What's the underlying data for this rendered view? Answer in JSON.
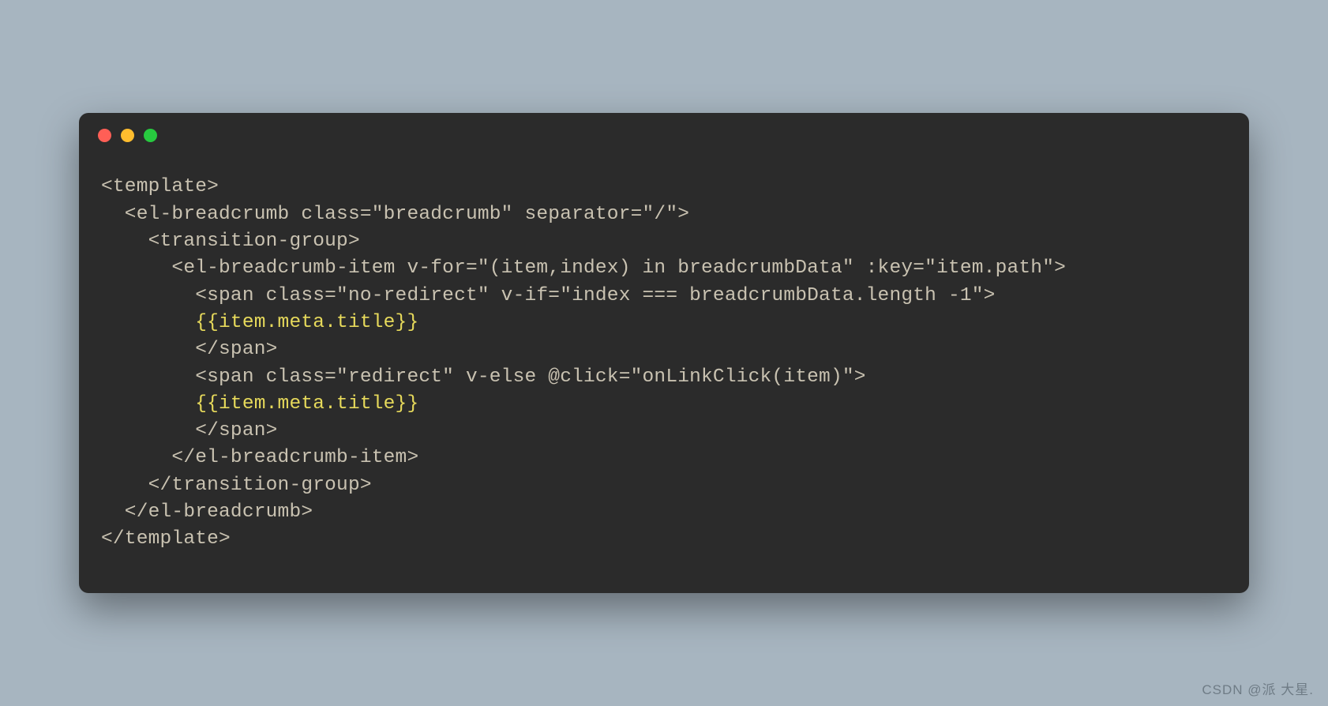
{
  "code": {
    "lines": [
      {
        "indent": 0,
        "type": "tag",
        "text": "<template>"
      },
      {
        "indent": 1,
        "type": "tag",
        "text": "<el-breadcrumb class=\"breadcrumb\" separator=\"/\">"
      },
      {
        "indent": 2,
        "type": "tag",
        "text": "<transition-group>"
      },
      {
        "indent": 3,
        "type": "tag",
        "text": "<el-breadcrumb-item v-for=\"(item,index) in breadcrumbData\" :key=\"item.path\">"
      },
      {
        "indent": 4,
        "type": "tag",
        "text": "<span class=\"no-redirect\" v-if=\"index === breadcrumbData.length -1\">"
      },
      {
        "indent": 4,
        "type": "highlight",
        "text": "{{item.meta.title}}"
      },
      {
        "indent": 4,
        "type": "tag",
        "text": "</span>"
      },
      {
        "indent": 4,
        "type": "tag",
        "text": "<span class=\"redirect\" v-else @click=\"onLinkClick(item)\">"
      },
      {
        "indent": 4,
        "type": "highlight",
        "text": "{{item.meta.title}}"
      },
      {
        "indent": 4,
        "type": "tag",
        "text": "</span>"
      },
      {
        "indent": 3,
        "type": "tag",
        "text": "</el-breadcrumb-item>"
      },
      {
        "indent": 2,
        "type": "tag",
        "text": "</transition-group>"
      },
      {
        "indent": 1,
        "type": "tag",
        "text": "</el-breadcrumb>"
      },
      {
        "indent": 0,
        "type": "tag",
        "text": "</template>"
      }
    ],
    "indentUnit": "  "
  },
  "watermark": "CSDN @派 大星."
}
